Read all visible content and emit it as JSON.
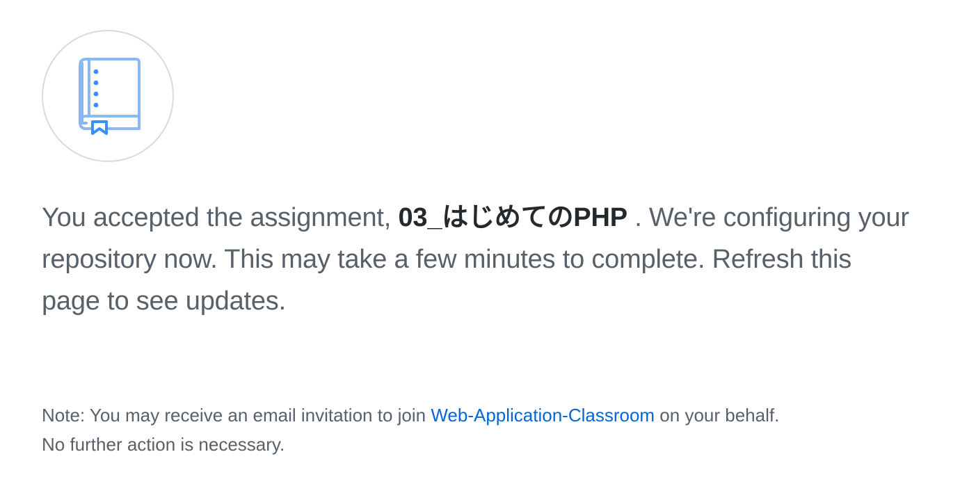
{
  "icon": {
    "name": "repo-book-icon",
    "colors": {
      "light": "#8ab8f2",
      "accent": "#3e8ef7",
      "circle_border": "#d8dadd"
    }
  },
  "message": {
    "prefix": "You accepted the assignment, ",
    "assignment_name": "03_はじめてのPHP",
    "suffix": " . We're configuring your repository now. This may take a few minutes to complete. Refresh this page to see updates."
  },
  "note": {
    "prefix": "Note: You may receive an email invitation to join ",
    "org_link": "Web-Application-Classroom",
    "suffix": " on your behalf.",
    "line2": "No further action is necessary."
  },
  "colors": {
    "text": "#586069",
    "emphasis": "#24292e",
    "link": "#0366d6"
  }
}
